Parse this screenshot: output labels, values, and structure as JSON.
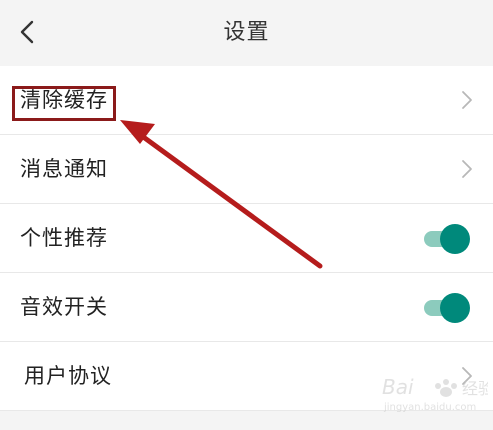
{
  "header": {
    "title": "设置",
    "back_icon": "chevron-left-icon"
  },
  "settings": [
    {
      "label": "清除缓存",
      "control": "chevron"
    },
    {
      "label": "消息通知",
      "control": "chevron"
    },
    {
      "label": "个性推荐",
      "control": "toggle",
      "on": true
    },
    {
      "label": "音效开关",
      "control": "toggle",
      "on": true
    },
    {
      "label": "用户协议",
      "control": "chevron"
    }
  ],
  "annotation": {
    "box_color": "#8b1a1a",
    "arrow_color": "#b51c1c"
  },
  "colors": {
    "toggle_knob": "#00897b",
    "toggle_track": "#8ccbbd",
    "background": "#f4f4f4"
  }
}
